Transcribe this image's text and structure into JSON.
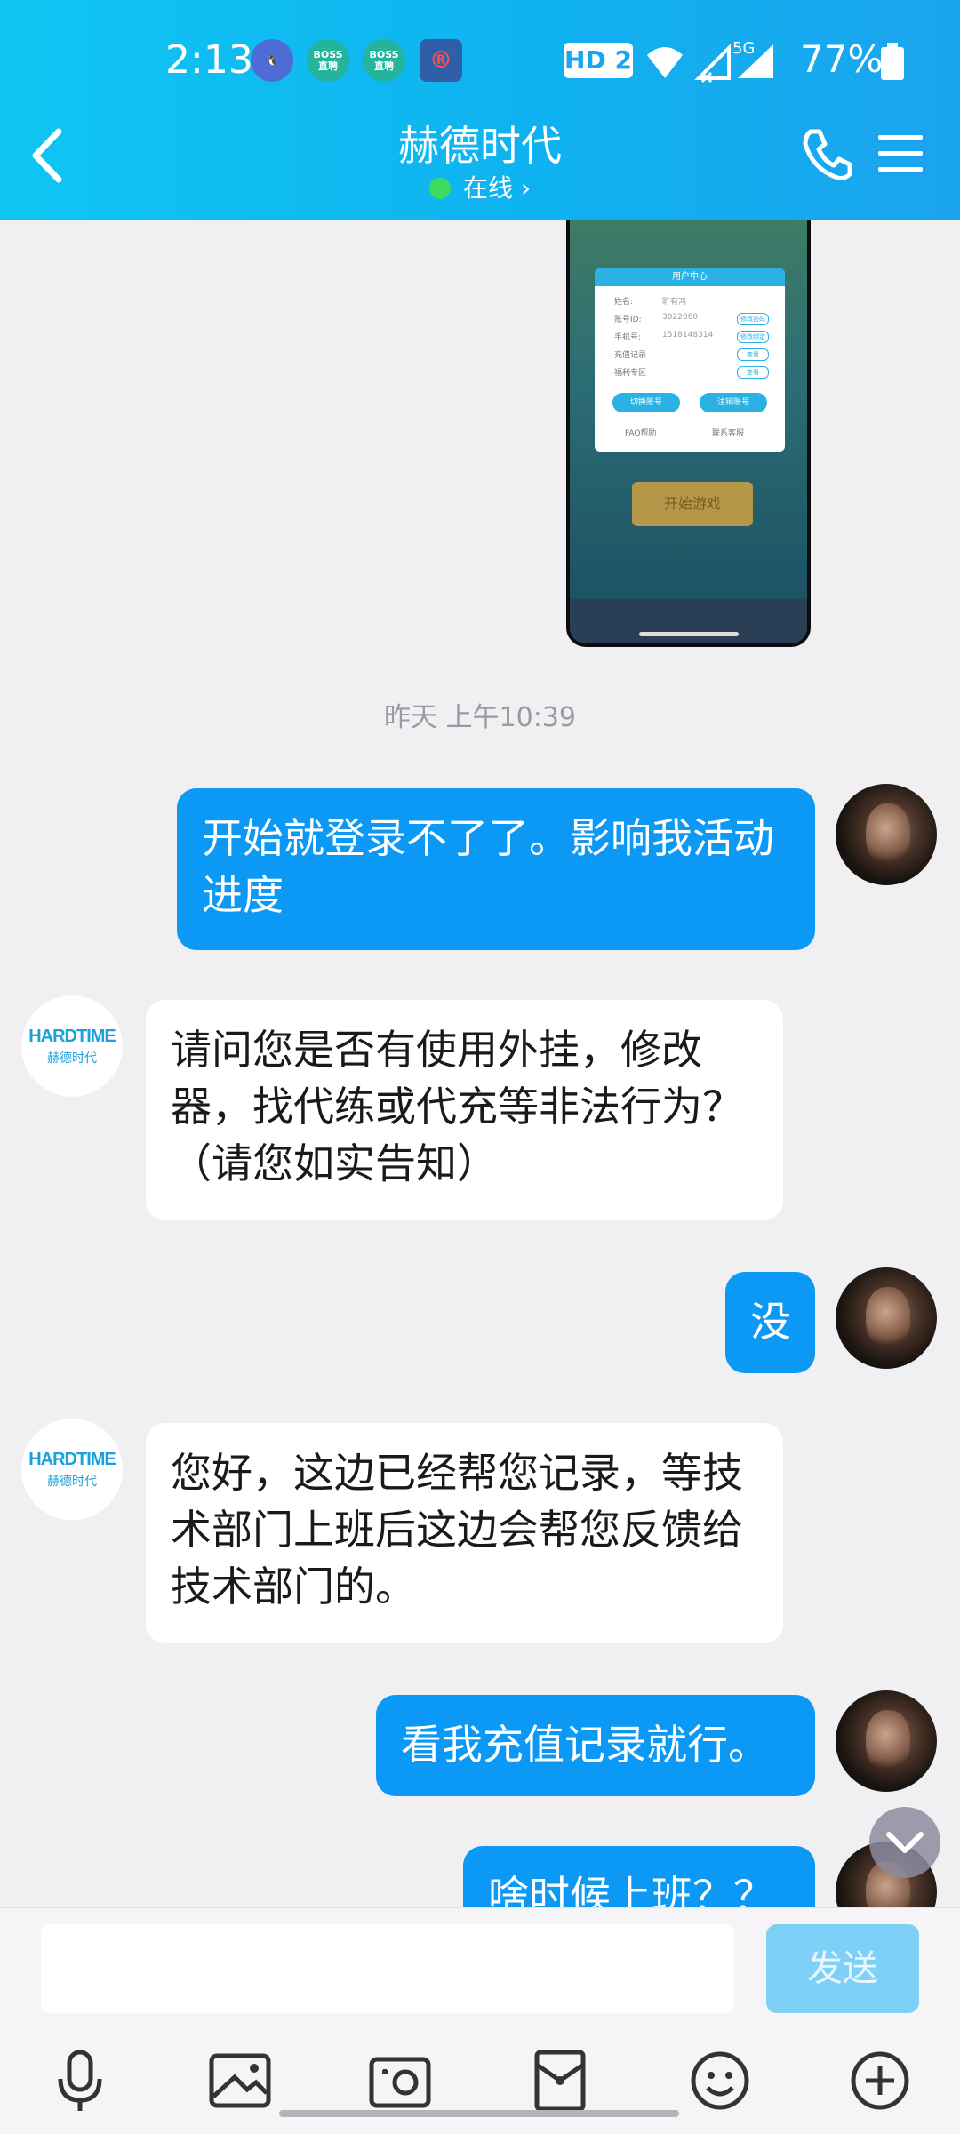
{
  "status_bar": {
    "time": "2:13",
    "network_badge": "HD 2",
    "network_type": "5G",
    "battery": "77%",
    "app_icons": [
      "penguin-app-icon",
      "boss-zhipin-icon",
      "boss-zhipin-icon",
      "railway-12306-icon"
    ],
    "boss_label": "BOSS\n直聘"
  },
  "header": {
    "title": "赫德时代",
    "status": "在线",
    "status_color": "#3ddc5c",
    "accent": "#0fb2f0"
  },
  "screenshot_thumb": {
    "panel_title": "用户中心",
    "rows": [
      {
        "label": "姓名:",
        "value": "旷有鸿"
      },
      {
        "label": "账号ID:",
        "value": "3022060",
        "btn": "修改密码"
      },
      {
        "label": "手机号:",
        "value": "1518148314",
        "btn": "修改绑定"
      },
      {
        "label": "充值记录",
        "value": "",
        "btn": "查看"
      },
      {
        "label": "福利专区",
        "value": "",
        "btn": "查看"
      }
    ],
    "switch_btn": "切换账号",
    "logout_btn": "注销账号",
    "faq": "FAQ帮助",
    "contact": "联系客服",
    "start_btn": "开始游戏"
  },
  "timestamp": "昨天 上午10:39",
  "messages": [
    {
      "from": "me",
      "text": "开始就登录不了了。影响我活动进度"
    },
    {
      "from": "them",
      "text": "请问您是否有使用外挂，修改器，找代练或代充等非法行为？（请您如实告知）"
    },
    {
      "from": "me",
      "text": "没"
    },
    {
      "from": "them",
      "text": "您好，这边已经帮您记录，等技术部门上班后这边会帮您反馈给技术部门的。"
    },
    {
      "from": "me",
      "text": "看我充值记录就行。"
    },
    {
      "from": "me",
      "text": "啥时候上班？？"
    }
  ],
  "logo": {
    "line1": "HARDTIME",
    "line2": "赫德时代"
  },
  "input": {
    "placeholder": "",
    "send_label": "发送"
  },
  "toolbar": [
    "microphone-icon",
    "photo-icon",
    "camera-icon",
    "red-packet-icon",
    "emoji-icon",
    "plus-icon"
  ]
}
